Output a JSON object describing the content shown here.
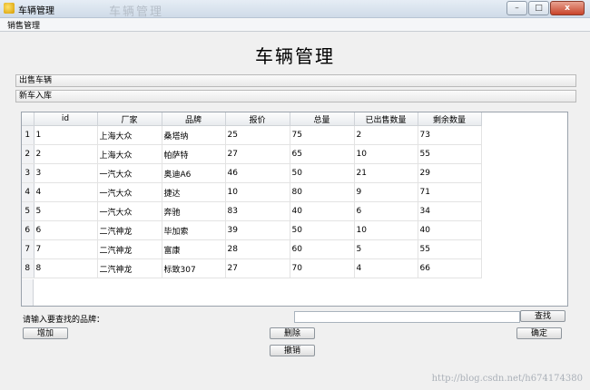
{
  "window": {
    "title": "车辆管理",
    "bg_ghost": "车辆管理",
    "minimize": "–",
    "maximize": "□",
    "close": "x"
  },
  "menu": {
    "items": [
      "销售管理"
    ]
  },
  "heading": "车辆管理",
  "sections": [
    "出售车辆",
    "新车入库"
  ],
  "table": {
    "columns": [
      "id",
      "厂家",
      "品牌",
      "报价",
      "总量",
      "已出售数量",
      "剩余数量"
    ],
    "rows": [
      {
        "num": "1",
        "cells": [
          "1",
          "上海大众",
          "桑塔纳",
          "25",
          "75",
          "2",
          "73"
        ]
      },
      {
        "num": "2",
        "cells": [
          "2",
          "上海大众",
          "帕萨特",
          "27",
          "65",
          "10",
          "55"
        ]
      },
      {
        "num": "3",
        "cells": [
          "3",
          "一汽大众",
          "奥迪A6",
          "46",
          "50",
          "21",
          "29"
        ]
      },
      {
        "num": "4",
        "cells": [
          "4",
          "一汽大众",
          "捷达",
          "10",
          "80",
          "9",
          "71"
        ]
      },
      {
        "num": "5",
        "cells": [
          "5",
          "一汽大众",
          "奔驰",
          "83",
          "40",
          "6",
          "34"
        ]
      },
      {
        "num": "6",
        "cells": [
          "6",
          "二汽神龙",
          "毕加索",
          "39",
          "50",
          "10",
          "40"
        ]
      },
      {
        "num": "7",
        "cells": [
          "7",
          "二汽神龙",
          "富康",
          "28",
          "60",
          "5",
          "55"
        ]
      },
      {
        "num": "8",
        "cells": [
          "8",
          "二汽神龙",
          "标致307",
          "27",
          "70",
          "4",
          "66"
        ]
      }
    ]
  },
  "search": {
    "label": "请输入要查找的品牌：",
    "value": "",
    "button": "查找"
  },
  "buttons": {
    "add": "增加",
    "delete": "删除",
    "confirm": "确定",
    "undo": "撤销"
  },
  "watermark": "http://blog.csdn.net/h674174380"
}
